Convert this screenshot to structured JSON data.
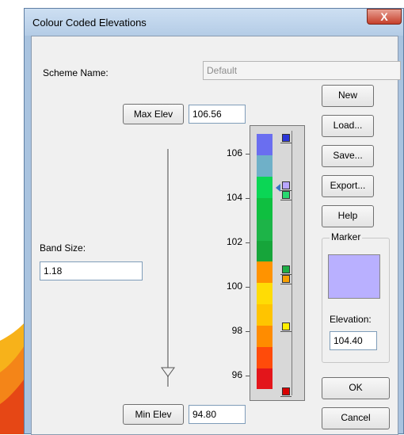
{
  "window": {
    "title": "Colour Coded Elevations",
    "close_glyph": "X"
  },
  "scheme": {
    "label": "Scheme Name:",
    "value": "Default"
  },
  "max_elev": {
    "button": "Max Elev",
    "value": "106.56"
  },
  "min_elev": {
    "button": "Min Elev",
    "value": "94.80"
  },
  "band_size": {
    "label": "Band Size:",
    "value": "1.18"
  },
  "scale": {
    "ticks": [
      "106",
      "104",
      "102",
      "100",
      "98",
      "96"
    ],
    "bands": [
      "#e3151b",
      "#ff4b0a",
      "#ff8c00",
      "#ffc400",
      "#ffdc05",
      "#ff9300",
      "#16a53a",
      "#1db448",
      "#0fbf40",
      "#0bd655",
      "#6fb0c8",
      "#6a6ef0"
    ],
    "markers": [
      {
        "name": "top",
        "color": "#2a35d8"
      },
      {
        "name": "104.4-a",
        "color": "#b8a6ff"
      },
      {
        "name": "104.4-b",
        "color": "#28d870"
      },
      {
        "name": "100-a",
        "color": "#1fae46"
      },
      {
        "name": "100-b",
        "color": "#f7a000"
      },
      {
        "name": "98",
        "color": "#ffef00"
      },
      {
        "name": "bottom",
        "color": "#d80000"
      }
    ]
  },
  "buttons": {
    "new": "New",
    "load": "Load...",
    "save": "Save...",
    "export": "Export...",
    "help": "Help",
    "ok": "OK",
    "cancel": "Cancel"
  },
  "marker_box": {
    "title": "Marker",
    "color": "#b9b0ff",
    "elevation_label": "Elevation:",
    "elevation_value": "104.40"
  },
  "slider": {
    "position_fraction": 0.04
  }
}
